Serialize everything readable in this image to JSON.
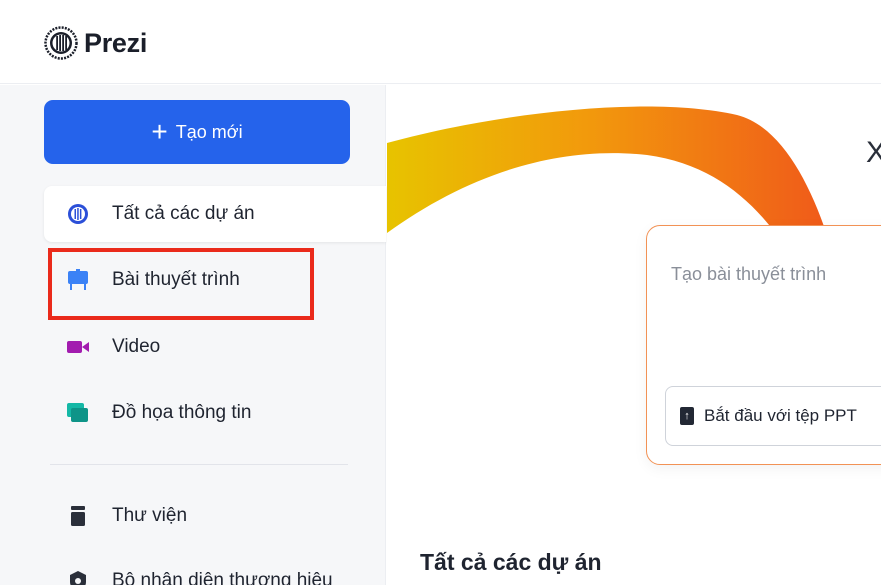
{
  "app": {
    "name": "Prezi"
  },
  "sidebar": {
    "create_label": "Tạo mới",
    "items": [
      {
        "label": "Tất cả các dự án",
        "icon": "projects-icon"
      },
      {
        "label": "Bài thuyết trình",
        "icon": "presentation-icon"
      },
      {
        "label": "Video",
        "icon": "video-icon"
      },
      {
        "label": "Đồ họa thông tin",
        "icon": "infographic-icon"
      },
      {
        "label": "Thư viện",
        "icon": "library-icon"
      },
      {
        "label": "Bộ nhận diện thương hiệu",
        "icon": "brand-kit-icon"
      }
    ]
  },
  "main": {
    "close_label": "X",
    "card": {
      "prompt": "Tạo bài thuyết trình",
      "ppt_button_label": "Bắt đầu với tệp PPT"
    },
    "section_title": "Tất cả các dự án"
  },
  "colors": {
    "accent": "#2563eb",
    "highlight": "#ea2a1b",
    "ribbon_start": "#e7c300",
    "ribbon_end": "#f05a1a",
    "card_border": "#f29255"
  }
}
